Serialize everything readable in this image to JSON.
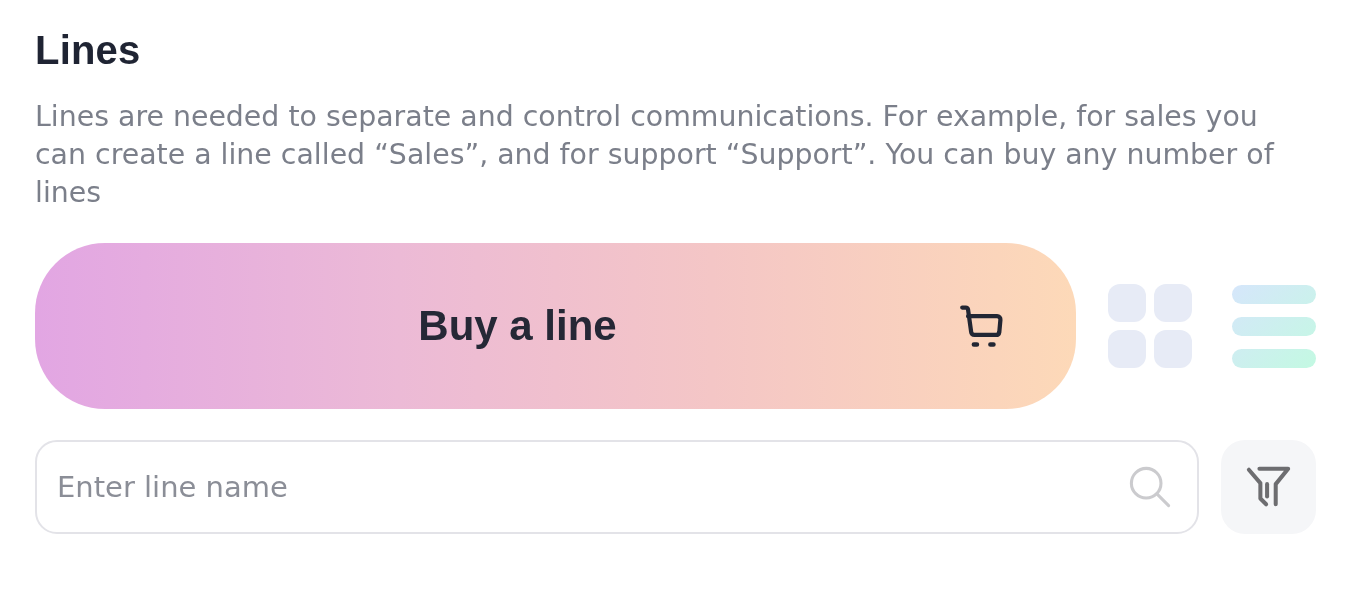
{
  "section": {
    "title": "Lines",
    "description": "Lines are needed to separate and control communications. For example, for sales you can create a line called “Sales”, and for support “Support”. You can buy any number of lines"
  },
  "buy_button": {
    "label": "Buy a line"
  },
  "view_toggle": [
    {
      "kind": "grid",
      "selected": false
    },
    {
      "kind": "list",
      "selected": true
    }
  ],
  "search": {
    "placeholder": "Enter line name"
  }
}
